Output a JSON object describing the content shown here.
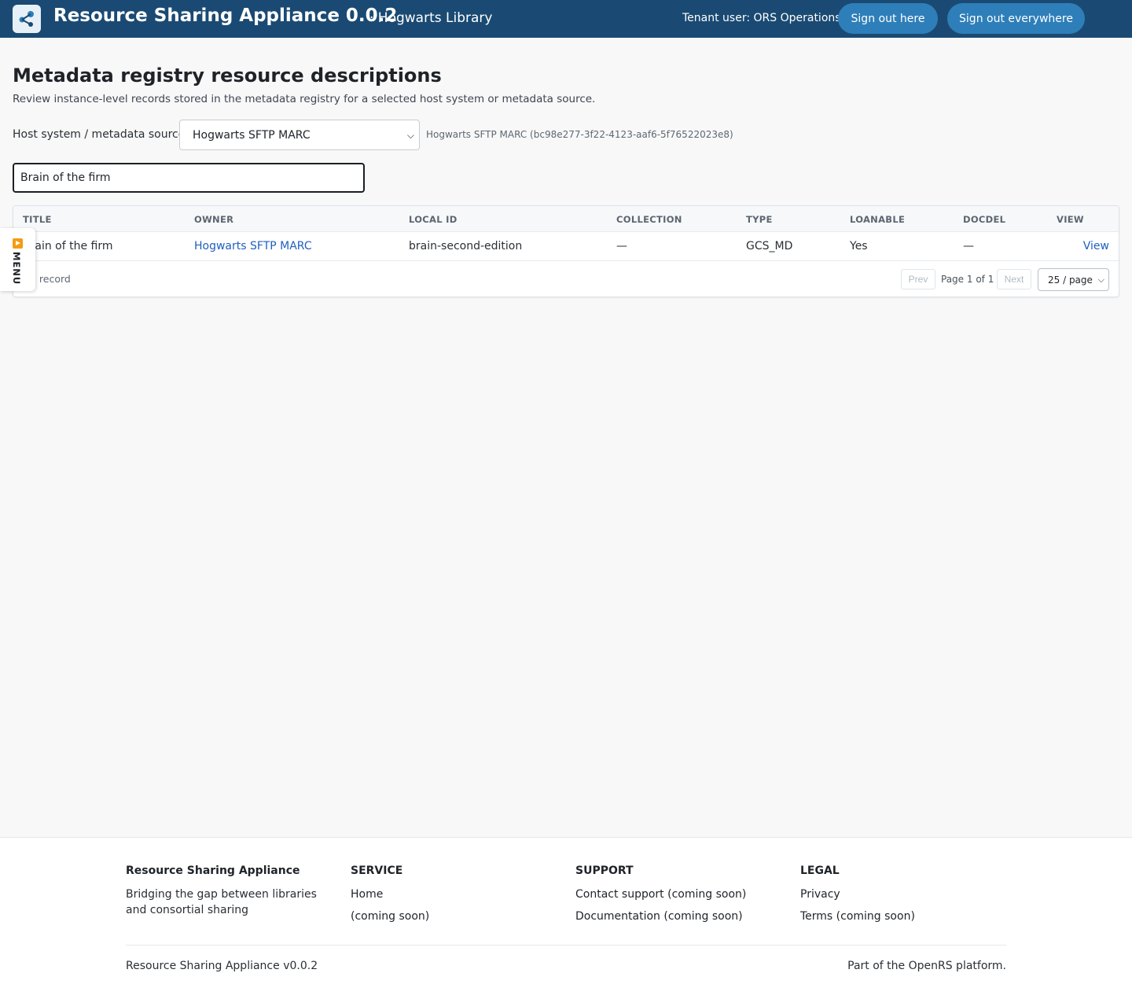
{
  "header": {
    "app_title": "Resource Sharing Appliance 0.0.2",
    "tenant_name": "· Hogwarts Library",
    "tenant_user": "Tenant user: ORS Operations",
    "sign_out_label": "Sign out here",
    "sign_out_all_label": "Sign out everywhere",
    "logo_icon": "share-network-icon"
  },
  "main": {
    "title": "Metadata registry resource descriptions",
    "description": "Review instance-level records stored in the metadata registry for a selected host system or metadata source.",
    "source_label": "Host system / metadata source",
    "source_selected": "Hogwarts SFTP MARC",
    "source_id_text": "Hogwarts SFTP MARC (bc98e277-3f22-4123-aaf6-5f76522023e8)",
    "search_value": "Brain of the firm"
  },
  "table": {
    "columns": [
      "TITLE",
      "OWNER",
      "LOCAL ID",
      "COLLECTION",
      "TYPE",
      "LOANABLE",
      "DOCDEL",
      "VIEW"
    ],
    "rows": [
      {
        "title": "Brain of the firm",
        "owner": "Hogwarts SFTP MARC",
        "local_id": "brain-second-edition",
        "collection": "—",
        "type": "GCS_MD",
        "loanable": "Yes",
        "docdel": "—",
        "view": "View"
      }
    ],
    "record_count": "1 record",
    "prev_label": "Prev",
    "page_label": "Page 1 of 1",
    "next_label": "Next",
    "per_page": "25 / page"
  },
  "side_menu": {
    "label": "MENU"
  },
  "footer": {
    "brand_title": "Resource Sharing Appliance",
    "brand_text": "Bridging the gap between libraries and consortial sharing",
    "service_title": "SERVICE",
    "service_links": [
      "Home",
      "(coming soon)"
    ],
    "support_title": "SUPPORT",
    "support_links": [
      "Contact support (coming soon)",
      "Documentation (coming soon)"
    ],
    "legal_title": "LEGAL",
    "legal_links": [
      "Privacy",
      "Terms (coming soon)"
    ],
    "version": "Resource Sharing Appliance v0.0.2",
    "platform": "Part of the OpenRS platform."
  },
  "colors": {
    "header_bg": "#1a4a73",
    "header_button": "#2e7fb9",
    "link": "#1f5fbf",
    "menu_accent": "#f39c12"
  }
}
